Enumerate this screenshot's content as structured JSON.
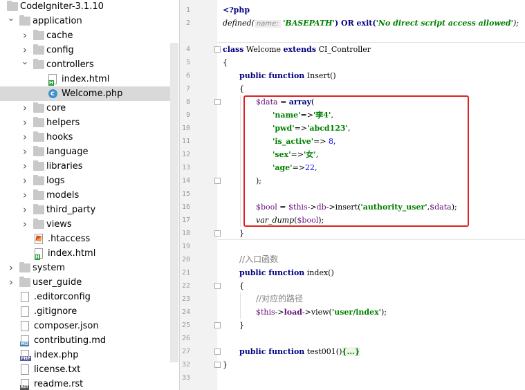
{
  "tree": [
    {
      "label": "CodeIgniter-3.1.10",
      "type": "root",
      "depth": 0,
      "arrow": ""
    },
    {
      "label": "application",
      "type": "folder",
      "depth": 0,
      "arrow": "v"
    },
    {
      "label": "cache",
      "type": "folder",
      "depth": 1,
      "arrow": ">"
    },
    {
      "label": "config",
      "type": "folder",
      "depth": 1,
      "arrow": ">"
    },
    {
      "label": "controllers",
      "type": "folder",
      "depth": 1,
      "arrow": "v"
    },
    {
      "label": "index.html",
      "type": "html",
      "depth": 2,
      "arrow": ""
    },
    {
      "label": "Welcome.php",
      "type": "class",
      "depth": 2,
      "arrow": "",
      "selected": true
    },
    {
      "label": "core",
      "type": "folder",
      "depth": 1,
      "arrow": ">"
    },
    {
      "label": "helpers",
      "type": "folder",
      "depth": 1,
      "arrow": ">"
    },
    {
      "label": "hooks",
      "type": "folder",
      "depth": 1,
      "arrow": ">"
    },
    {
      "label": "language",
      "type": "folder",
      "depth": 1,
      "arrow": ">"
    },
    {
      "label": "libraries",
      "type": "folder",
      "depth": 1,
      "arrow": ">"
    },
    {
      "label": "logs",
      "type": "folder",
      "depth": 1,
      "arrow": ">"
    },
    {
      "label": "models",
      "type": "folder",
      "depth": 1,
      "arrow": ">"
    },
    {
      "label": "third_party",
      "type": "folder",
      "depth": 1,
      "arrow": ">"
    },
    {
      "label": "views",
      "type": "folder",
      "depth": 1,
      "arrow": ">"
    },
    {
      "label": ".htaccess",
      "type": "ht",
      "depth": 1,
      "arrow": ""
    },
    {
      "label": "index.html",
      "type": "html",
      "depth": 1,
      "arrow": ""
    },
    {
      "label": "system",
      "type": "folder",
      "depth": 0,
      "arrow": ">"
    },
    {
      "label": "user_guide",
      "type": "folder",
      "depth": 0,
      "arrow": ">"
    },
    {
      "label": ".editorconfig",
      "type": "file",
      "depth": 0,
      "arrow": ""
    },
    {
      "label": ".gitignore",
      "type": "file",
      "depth": 0,
      "arrow": ""
    },
    {
      "label": "composer.json",
      "type": "file",
      "depth": 0,
      "arrow": ""
    },
    {
      "label": "contributing.md",
      "type": "md",
      "depth": 0,
      "arrow": ""
    },
    {
      "label": "index.php",
      "type": "php",
      "depth": 0,
      "arrow": ""
    },
    {
      "label": "license.txt",
      "type": "file",
      "depth": 0,
      "arrow": ""
    },
    {
      "label": "readme.rst",
      "type": "rst",
      "depth": 0,
      "arrow": ""
    }
  ],
  "editor": {
    "line_numbers": [
      "1",
      "2",
      "",
      "4",
      "5",
      "6",
      "7",
      "8",
      "9",
      "10",
      "11",
      "12",
      "13",
      "14",
      "15",
      "16",
      "17",
      "18",
      "19",
      "20",
      "21",
      "22",
      "23",
      "24",
      "25",
      "26",
      "27",
      "32",
      "33"
    ],
    "line_tops": [],
    "code": {
      "l1": "<?php",
      "l2_a": "defined(",
      "l2_hint": "name:",
      "l2_b": "'BASEPATH'",
      "l2_c": ") OR exit(",
      "l2_d": "'No direct script access allowed'",
      "l2_e": ");",
      "l4_kw1": "class",
      "l4_a": " Welcome ",
      "l4_kw2": "extends",
      "l4_b": " CI_Controller",
      "l5": "{",
      "l6_kw": "public function",
      "l6_a": " Insert()",
      "l7": "{",
      "l8_var": "$data",
      "l8_a": " = ",
      "l8_kw": "array",
      "l8_b": "(",
      "l9_s1": "'name'",
      "l9_a": "=>",
      "l9_s2": "'李4'",
      "l9_b": ",",
      "l10_s1": "'pwd'",
      "l10_a": "=>",
      "l10_s2": "'abcd123'",
      "l10_b": ",",
      "l11_s1": "'is_active'",
      "l11_a": "=> ",
      "l11_n": "8",
      "l11_b": ",",
      "l12_s1": "'sex'",
      "l12_a": "=>",
      "l12_s2": "'女'",
      "l12_b": ",",
      "l13_s1": "'age'",
      "l13_a": "=>",
      "l13_n": "22",
      "l13_b": ",",
      "l14": ");",
      "l16_var1": "$bool",
      "l16_a": " = ",
      "l16_var2": "$this",
      "l16_b": "->",
      "l16_f": "db",
      "l16_c": "->insert(",
      "l16_s": "'authority_user'",
      "l16_d": ",",
      "l16_var3": "$data",
      "l16_e": ");",
      "l17_f": "var_dump",
      "l17_a": "(",
      "l17_var": "$bool",
      "l17_b": ");",
      "l18": "}",
      "l20": "//入口函数",
      "l21_kw": "public function",
      "l21_a": " index()",
      "l22": "{",
      "l23": "//对应的路径",
      "l24_var": "$this",
      "l24_a": "->",
      "l24_f": "load",
      "l24_b": "->view(",
      "l24_s": "'user/index'",
      "l24_c": ");",
      "l25": "}",
      "l27_kw": "public function",
      "l27_a": " test001()",
      "l27_b": "{...}",
      "l32": "}"
    }
  },
  "colors": {
    "keyword": "#000080",
    "string": "#008000",
    "variable": "#660e7a",
    "number": "#0000ff",
    "highlight_box": "#e02020"
  }
}
